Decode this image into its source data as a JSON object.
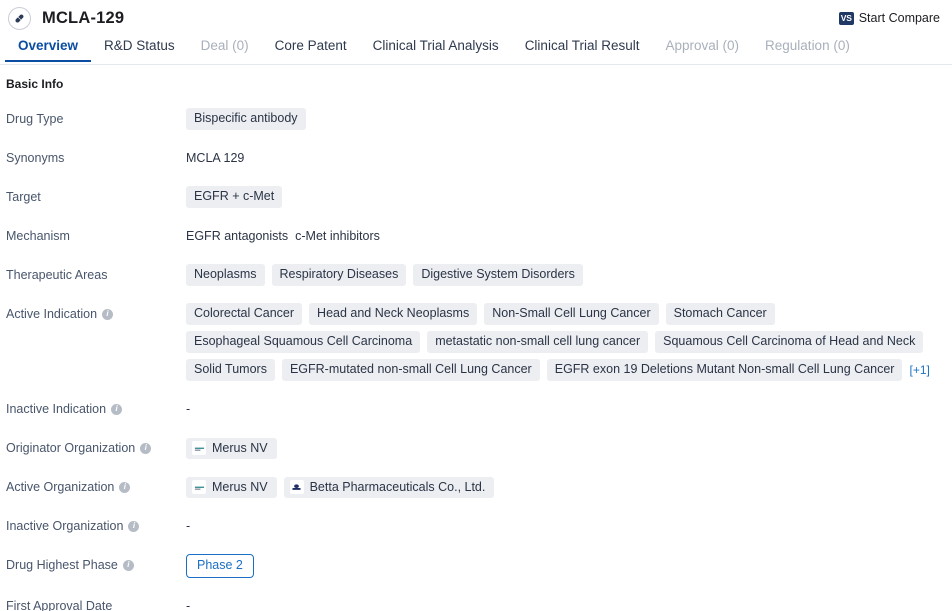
{
  "header": {
    "icon": "pill-icon",
    "title": "MCLA-129",
    "compare": {
      "badge": "VS",
      "label": "Start Compare"
    }
  },
  "tabs": [
    {
      "label": "Overview",
      "state": "active"
    },
    {
      "label": "R&D Status",
      "state": "normal"
    },
    {
      "label": "Deal (0)",
      "state": "disabled"
    },
    {
      "label": "Core Patent",
      "state": "normal"
    },
    {
      "label": "Clinical Trial Analysis",
      "state": "normal"
    },
    {
      "label": "Clinical Trial Result",
      "state": "normal"
    },
    {
      "label": "Approval (0)",
      "state": "disabled"
    },
    {
      "label": "Regulation (0)",
      "state": "disabled"
    }
  ],
  "section": {
    "title": "Basic Info"
  },
  "fields": {
    "drug_type": {
      "label": "Drug Type",
      "tags": [
        "Bispecific antibody"
      ]
    },
    "synonyms": {
      "label": "Synonyms",
      "text": "MCLA 129"
    },
    "target": {
      "label": "Target",
      "tags": [
        "EGFR + c-Met"
      ]
    },
    "mechanism": {
      "label": "Mechanism",
      "items": [
        "EGFR antagonists",
        "c-Met inhibitors"
      ]
    },
    "therapeutic_areas": {
      "label": "Therapeutic Areas",
      "tags": [
        "Neoplasms",
        "Respiratory Diseases",
        "Digestive System Disorders"
      ]
    },
    "active_indication": {
      "label": "Active Indication",
      "info": true,
      "tags": [
        "Colorectal Cancer",
        "Head and Neck Neoplasms",
        "Non-Small Cell Lung Cancer",
        "Stomach Cancer",
        "Esophageal Squamous Cell Carcinoma",
        "metastatic non-small cell lung cancer",
        "Squamous Cell Carcinoma of Head and Neck",
        "Solid Tumors",
        "EGFR-mutated non-small Cell Lung Cancer",
        "EGFR exon 19 Deletions Mutant Non-small Cell Lung Cancer"
      ],
      "more": "[+1]"
    },
    "inactive_indication": {
      "label": "Inactive Indication",
      "info": true,
      "value": "-"
    },
    "originator_organization": {
      "label": "Originator Organization",
      "info": true,
      "orgs": [
        {
          "name": "Merus NV",
          "logo": "merus-logo"
        }
      ]
    },
    "active_organization": {
      "label": "Active Organization",
      "info": true,
      "orgs": [
        {
          "name": "Merus NV",
          "logo": "merus-logo"
        },
        {
          "name": "Betta Pharmaceuticals Co., Ltd.",
          "logo": "betta-logo"
        }
      ]
    },
    "inactive_organization": {
      "label": "Inactive Organization",
      "info": true,
      "value": "-"
    },
    "drug_highest_phase": {
      "label": "Drug Highest Phase",
      "info": true,
      "badge": "Phase 2"
    },
    "first_approval_date": {
      "label": "First Approval Date",
      "value": "-"
    }
  },
  "colors": {
    "accent_blue": "#0b4da2",
    "link_blue": "#1a73c7",
    "tag_bg": "#eceef2",
    "phase_blue": "#1a6fc4"
  }
}
